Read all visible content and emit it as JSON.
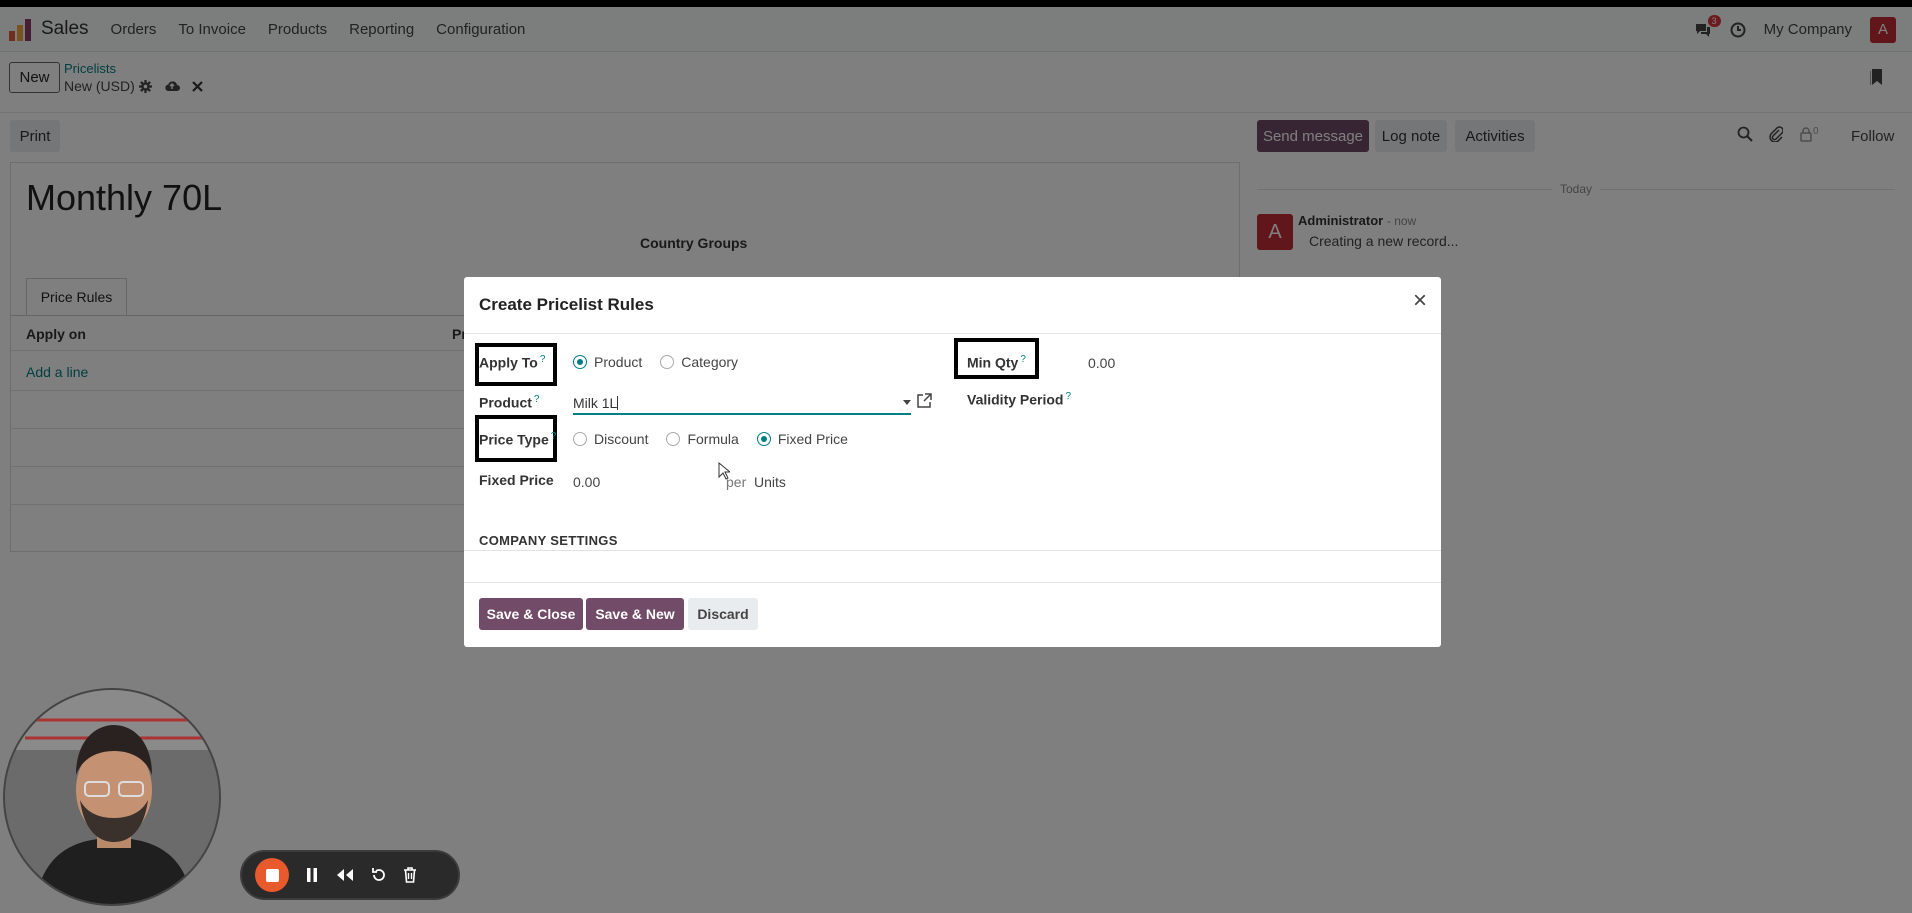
{
  "navbar": {
    "app_name": "Sales",
    "menu": [
      "Orders",
      "To Invoice",
      "Products",
      "Reporting",
      "Configuration"
    ],
    "chat_badge": "3",
    "company": "My Company",
    "user_initial": "A"
  },
  "control": {
    "new_label": "New",
    "breadcrumb_parent": "Pricelists",
    "breadcrumb_current": "New (USD)"
  },
  "form": {
    "print_label": "Print",
    "title": "Monthly 70L",
    "country_groups_label": "Country Groups",
    "tab_label": "Price Rules",
    "col_apply_on": "Apply on",
    "col_second_partial": "Pr",
    "add_line": "Add a line"
  },
  "chatter": {
    "send_message": "Send message",
    "log_note": "Log note",
    "activities": "Activities",
    "followers_count": "0",
    "follow": "Follow",
    "today": "Today",
    "author_initial": "A",
    "author": "Administrator",
    "time": "- now",
    "message": "Creating a new record..."
  },
  "dialog": {
    "title": "Create Pricelist Rules",
    "apply_to_label": "Apply To",
    "apply_to_options": [
      "Product",
      "Category"
    ],
    "apply_to_selected": "Product",
    "product_label": "Product",
    "product_value": "Milk 1L",
    "price_type_label": "Price Type",
    "price_type_options": [
      "Discount",
      "Formula",
      "Fixed Price"
    ],
    "price_type_selected": "Fixed Price",
    "fixed_price_label": "Fixed Price",
    "fixed_price_value": "0.00",
    "per_label": "per",
    "uom_value": "Units",
    "min_qty_label": "Min Qty",
    "min_qty_value": "0.00",
    "validity_label": "Validity Period",
    "help_mark": "?",
    "company_settings": "COMPANY SETTINGS",
    "save_close": "Save & Close",
    "save_new": "Save & New",
    "discard": "Discard"
  },
  "colors": {
    "brand": "#714b67",
    "accent": "#017e84",
    "overlay": "rgba(0,0,0,0.5)",
    "recorder_stop": "#e85a2b"
  }
}
